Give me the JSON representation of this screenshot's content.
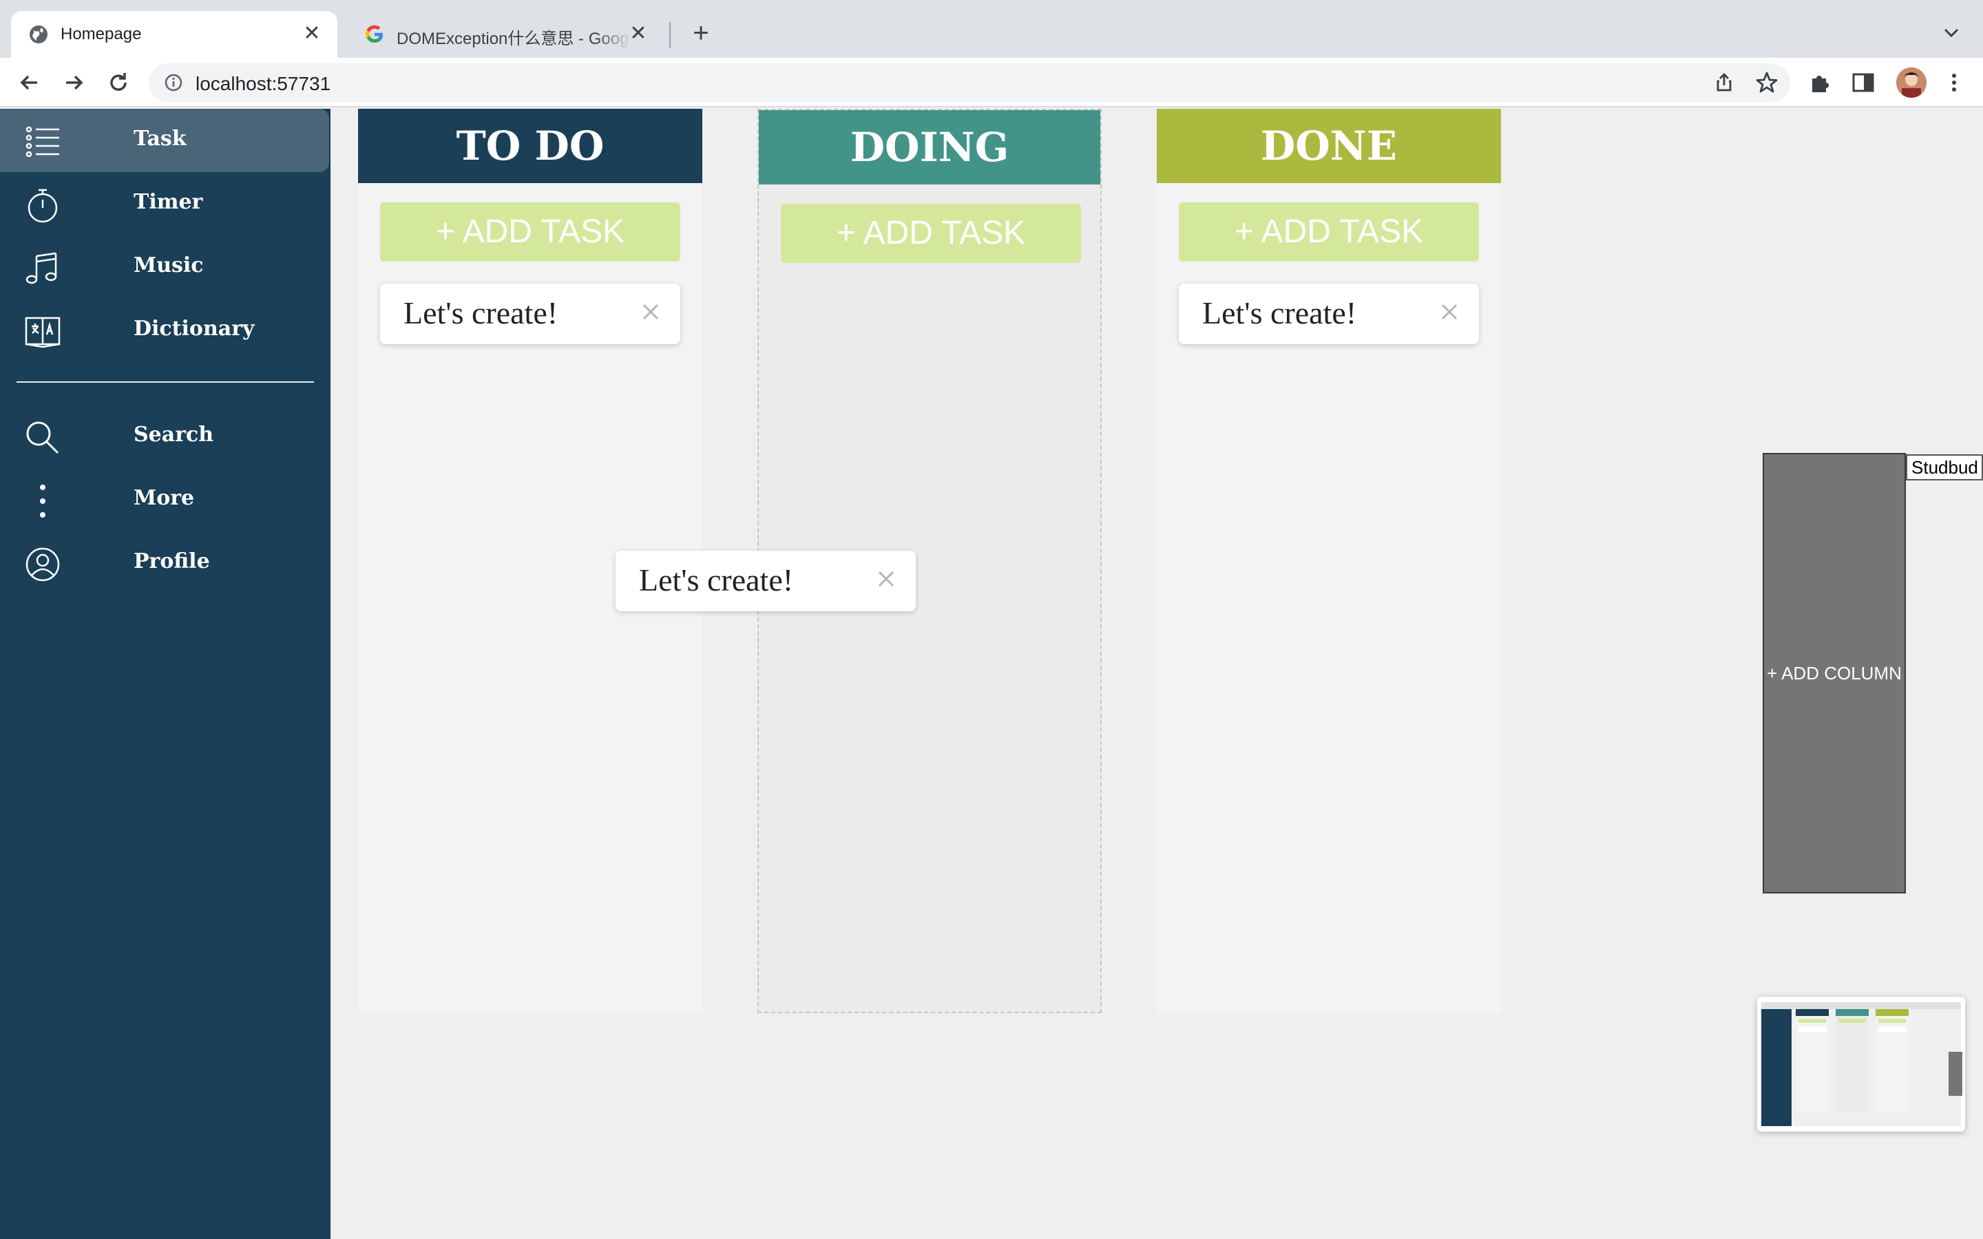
{
  "browser": {
    "tabs": [
      {
        "title": "Homepage",
        "favicon": "globe-icon",
        "active": true
      },
      {
        "title": "DOMException什么意思 - Google",
        "favicon": "google-icon",
        "active": false
      }
    ],
    "url": "localhost:57731"
  },
  "sidebar": {
    "items": [
      {
        "label": "Task",
        "icon": "list-icon",
        "active": true
      },
      {
        "label": "Timer",
        "icon": "stopwatch-icon"
      },
      {
        "label": "Music",
        "icon": "music-note-icon"
      },
      {
        "label": "Dictionary",
        "icon": "dictionary-icon"
      },
      {
        "label": "Search",
        "icon": "search-icon"
      },
      {
        "label": "More",
        "icon": "more-vertical-icon"
      },
      {
        "label": "Profile",
        "icon": "profile-icon"
      }
    ]
  },
  "board": {
    "columns": [
      {
        "title": "TO DO",
        "color": "#1a3f57",
        "add_label": "+ ADD TASK",
        "cards": [
          "Let's create!"
        ]
      },
      {
        "title": "DOING",
        "color": "#429488",
        "add_label": "+ ADD TASK",
        "cards": []
      },
      {
        "title": "DONE",
        "color": "#abba3e",
        "add_label": "+ ADD TASK",
        "cards": [
          "Let's create!"
        ]
      }
    ],
    "dragging_card": "Let's create!",
    "add_column_label": "+ ADD COLUMN",
    "floating_label": "Studbud",
    "add_button_color": "#d4e89c"
  }
}
